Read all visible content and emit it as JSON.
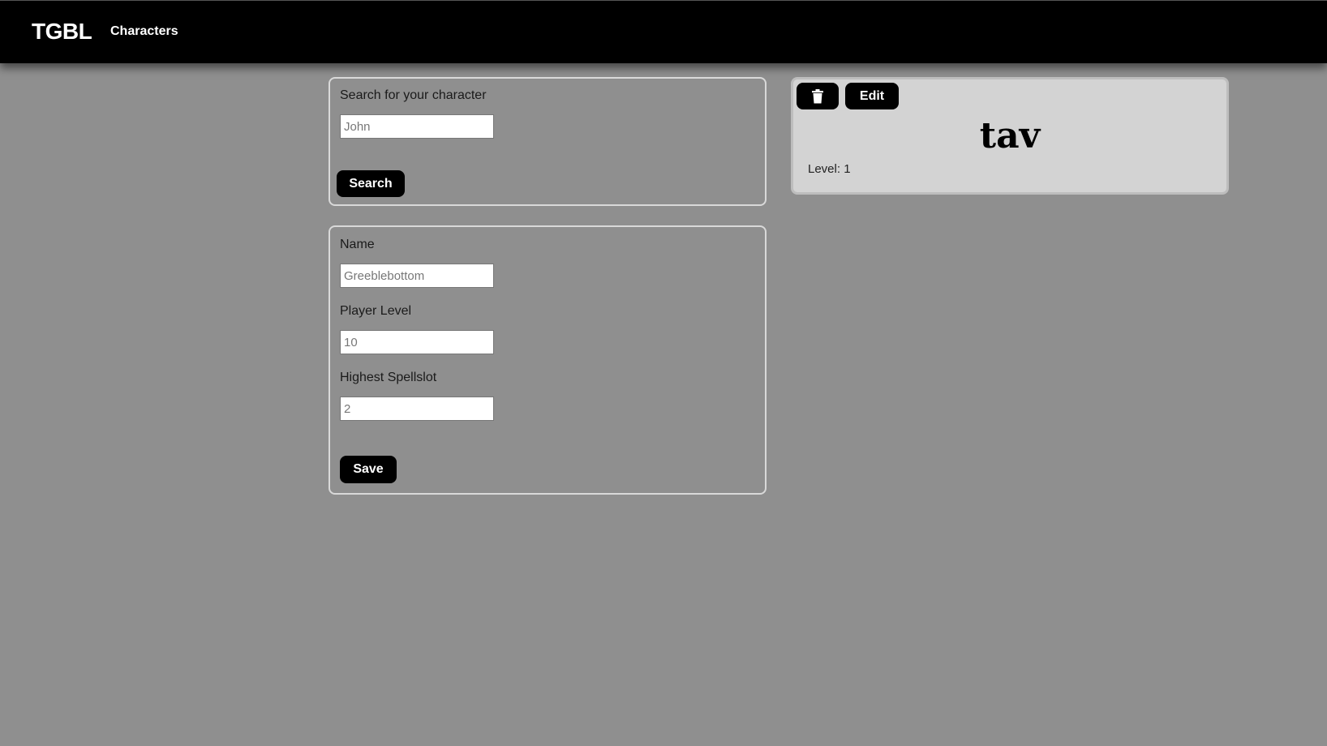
{
  "nav": {
    "brand": "TGBL",
    "links": [
      {
        "label": "Characters"
      }
    ]
  },
  "search": {
    "label": "Search for your character",
    "placeholder": "John",
    "button_label": "Search"
  },
  "form": {
    "name_label": "Name",
    "name_placeholder": "Greeblebottom",
    "level_label": "Player Level",
    "level_placeholder": "10",
    "spellslot_label": "Highest Spellslot",
    "spellslot_placeholder": "2",
    "save_label": "Save"
  },
  "card": {
    "delete_icon": "trash-icon",
    "edit_label": "Edit",
    "title": "tav",
    "level_text": "Level: 1"
  },
  "colors": {
    "background": "#8f8f8f",
    "navbar": "#000000",
    "card_bg": "#d3d3d3",
    "button": "#000000"
  }
}
